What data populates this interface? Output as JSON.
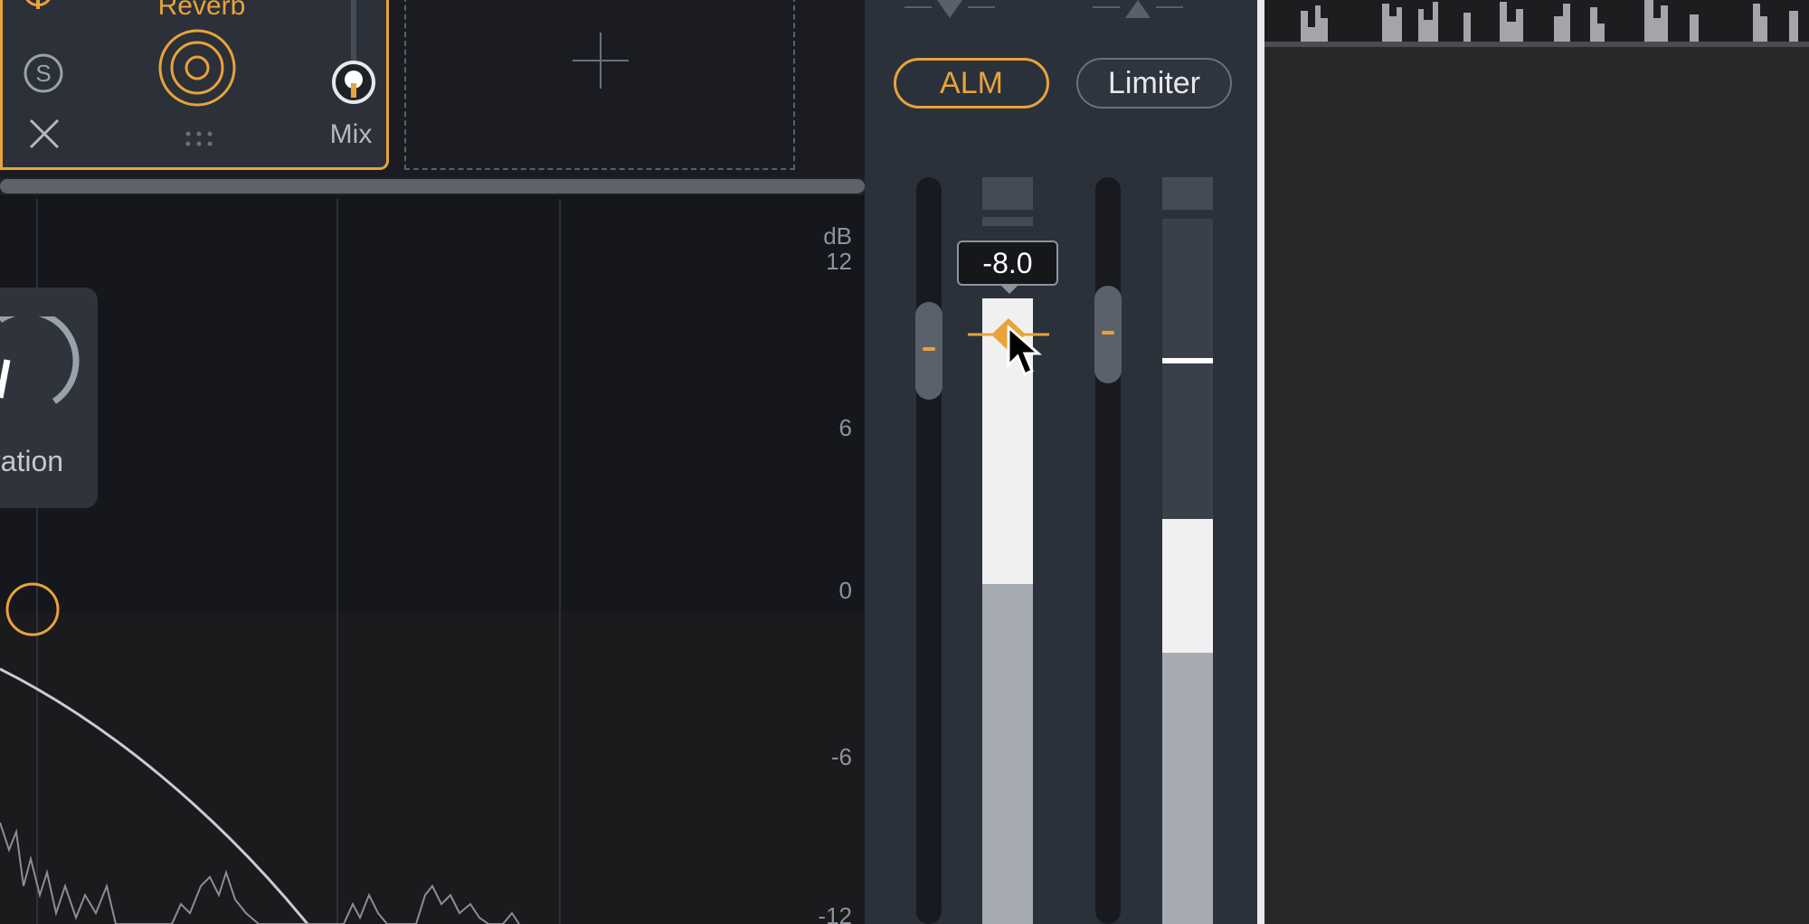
{
  "module": {
    "name": "Reverb",
    "mix_label": "Mix",
    "solo_label": "S",
    "icons": [
      "power-icon",
      "solo-icon",
      "remove-icon",
      "reverb-icon",
      "drag-handle-icon",
      "mix-slider-icon"
    ]
  },
  "empty_slot": {
    "icon": "add-module-icon"
  },
  "analyzer": {
    "unit": "dB",
    "scale_labels": [
      "12",
      "6",
      "0",
      "-6",
      "-12"
    ],
    "popup_label": "ration"
  },
  "meters": {
    "alm_label": "ALM",
    "limiter_label": "Limiter",
    "tooltip_value": "-8.0"
  },
  "colors": {
    "accent": "#e8a33a",
    "panel": "#2b313a",
    "analyzer_bg": "#15171c",
    "meter_fill": "#f0f0f0",
    "meter_level": "#a6abb2"
  }
}
